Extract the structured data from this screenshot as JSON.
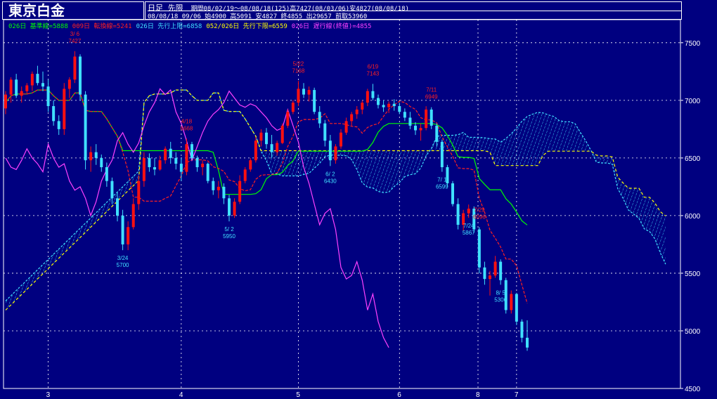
{
  "title": "東京白金",
  "info": {
    "line1_label": "日足 先限",
    "line1": "期間08/02/19～08/08/18(125)高7427(08/03/06)安4827(08/08/18)",
    "line2": "08/08/18 09/06 始4900 高5091 安4827 終4855 出29657 前取53960"
  },
  "legend": [
    {
      "text": "026日 基準線=5888",
      "color": "#00ff00"
    },
    {
      "text": "009日 転換線=5241",
      "color": "#ff2020"
    },
    {
      "text": "026日 先行上限=6858",
      "color": "#40e0ff"
    },
    {
      "text": "052/026日 先行下限=6559",
      "color": "#ffff00"
    },
    {
      "text": "026日 遅行線(終値)=4855",
      "color": "#ff40ff"
    }
  ],
  "colors": {
    "background": "#000080",
    "grid": "#ffffff",
    "up_candle": "#ff1010",
    "down_candle": "#40e0ff",
    "kijun": "#00ff00",
    "tenkan": "#ff2020",
    "span_a": "#40e0ff",
    "span_b": "#ffff00",
    "chikou": "#ff40ff",
    "annotation_high": "#ff2020",
    "annotation_low": "#40e0ff"
  },
  "chart_data": {
    "type": "candlestick",
    "ylim": [
      4500,
      7700
    ],
    "y_ticks": [
      "7500",
      "7000",
      "6500",
      "6000",
      "5500",
      "5000",
      "4500"
    ],
    "x_ticks": [
      "3",
      "4",
      "5",
      "6",
      "7",
      "8"
    ],
    "annotations": [
      {
        "kind": "high",
        "date": "3/ 6",
        "value": "7427"
      },
      {
        "kind": "low",
        "date": "3/24",
        "value": "5700"
      },
      {
        "kind": "high",
        "date": "4/18",
        "value": "6668"
      },
      {
        "kind": "low",
        "date": "5/ 2",
        "value": "5950"
      },
      {
        "kind": "high",
        "date": "5/22",
        "value": "7168"
      },
      {
        "kind": "low",
        "date": "6/ 2",
        "value": "6430"
      },
      {
        "kind": "high",
        "date": "6/19",
        "value": "7143"
      },
      {
        "kind": "high",
        "date": "7/11",
        "value": "6949"
      },
      {
        "kind": "low",
        "date": "7/ 1",
        "value": "6599"
      },
      {
        "kind": "high",
        "date": "7/29",
        "value": "6096"
      },
      {
        "kind": "low",
        "date": "7/24",
        "value": "5867"
      },
      {
        "kind": "low",
        "date": "8/ 5",
        "value": "5306"
      }
    ],
    "candles_ohlc": [
      [
        6930,
        7080,
        6880,
        7050
      ],
      [
        7050,
        7200,
        6980,
        7180
      ],
      [
        7180,
        7230,
        7020,
        7040
      ],
      [
        7040,
        7120,
        6980,
        7080
      ],
      [
        7080,
        7150,
        7050,
        7130
      ],
      [
        7130,
        7250,
        7080,
        7230
      ],
      [
        7230,
        7300,
        7130,
        7150
      ],
      [
        7150,
        7250,
        7080,
        7120
      ],
      [
        7120,
        7180,
        6900,
        6950
      ],
      [
        6950,
        7000,
        6780,
        6820
      ],
      [
        6820,
        6870,
        6700,
        6750
      ],
      [
        6750,
        7150,
        6700,
        7100
      ],
      [
        7100,
        7200,
        7020,
        7180
      ],
      [
        7180,
        7427,
        7150,
        7380
      ],
      [
        7380,
        7400,
        7000,
        7050
      ],
      [
        7050,
        7080,
        6400,
        6480
      ],
      [
        6480,
        6600,
        6380,
        6550
      ],
      [
        6550,
        6620,
        6440,
        6500
      ],
      [
        6500,
        6530,
        6380,
        6420
      ],
      [
        6420,
        6460,
        6250,
        6300
      ],
      [
        6300,
        6330,
        6100,
        6150
      ],
      [
        6150,
        6200,
        5950,
        6000
      ],
      [
        6000,
        6050,
        5700,
        5750
      ],
      [
        5750,
        5950,
        5700,
        5900
      ],
      [
        5900,
        6150,
        5880,
        6100
      ],
      [
        6100,
        6350,
        6050,
        6300
      ],
      [
        6300,
        6550,
        6250,
        6500
      ],
      [
        6500,
        6540,
        6380,
        6420
      ],
      [
        6420,
        6500,
        6350,
        6400
      ],
      [
        6400,
        6520,
        6390,
        6480
      ],
      [
        6480,
        6600,
        6450,
        6580
      ],
      [
        6580,
        6640,
        6450,
        6500
      ],
      [
        6500,
        6550,
        6400,
        6450
      ],
      [
        6450,
        6500,
        6300,
        6380
      ],
      [
        6380,
        6668,
        6350,
        6620
      ],
      [
        6620,
        6640,
        6480,
        6500
      ],
      [
        6500,
        6520,
        6380,
        6420
      ],
      [
        6420,
        6480,
        6350,
        6450
      ],
      [
        6450,
        6460,
        6280,
        6300
      ],
      [
        6300,
        6330,
        6180,
        6220
      ],
      [
        6220,
        6300,
        6150,
        6250
      ],
      [
        6250,
        6280,
        6100,
        6150
      ],
      [
        6150,
        6180,
        5950,
        6000
      ],
      [
        6000,
        6150,
        5980,
        6120
      ],
      [
        6120,
        6350,
        6100,
        6300
      ],
      [
        6300,
        6420,
        6280,
        6400
      ],
      [
        6400,
        6500,
        6380,
        6480
      ],
      [
        6480,
        6680,
        6460,
        6650
      ],
      [
        6650,
        6750,
        6600,
        6720
      ],
      [
        6720,
        6760,
        6580,
        6620
      ],
      [
        6620,
        6700,
        6500,
        6550
      ],
      [
        6550,
        6650,
        6520,
        6630
      ],
      [
        6630,
        6800,
        6620,
        6780
      ],
      [
        6780,
        6920,
        6760,
        6900
      ],
      [
        6900,
        7000,
        6880,
        6980
      ],
      [
        6980,
        7168,
        6950,
        7100
      ],
      [
        7100,
        7150,
        7020,
        7050
      ],
      [
        7050,
        7120,
        6990,
        7090
      ],
      [
        7090,
        7110,
        6880,
        6900
      ],
      [
        6900,
        6950,
        6760,
        6800
      ],
      [
        6800,
        6830,
        6600,
        6650
      ],
      [
        6650,
        6700,
        6430,
        6480
      ],
      [
        6480,
        6620,
        6450,
        6600
      ],
      [
        6600,
        6750,
        6580,
        6720
      ],
      [
        6720,
        6850,
        6700,
        6820
      ],
      [
        6820,
        6900,
        6780,
        6880
      ],
      [
        6880,
        6950,
        6840,
        6920
      ],
      [
        6920,
        7000,
        6880,
        6980
      ],
      [
        6980,
        7100,
        6950,
        7080
      ],
      [
        7080,
        7143,
        7000,
        7020
      ],
      [
        7020,
        7050,
        6930,
        6960
      ],
      [
        6960,
        7000,
        6900,
        6940
      ],
      [
        6940,
        6990,
        6890,
        6970
      ],
      [
        6970,
        7010,
        6910,
        6950
      ],
      [
        6950,
        6980,
        6880,
        6900
      ],
      [
        6900,
        6930,
        6820,
        6850
      ],
      [
        6850,
        6900,
        6750,
        6780
      ],
      [
        6780,
        6810,
        6700,
        6740
      ],
      [
        6740,
        6800,
        6650,
        6760
      ],
      [
        6760,
        6949,
        6740,
        6920
      ],
      [
        6920,
        6940,
        6750,
        6780
      ],
      [
        6780,
        6800,
        6599,
        6640
      ],
      [
        6640,
        6660,
        6380,
        6420
      ],
      [
        6420,
        6440,
        6250,
        6280
      ],
      [
        6280,
        6300,
        6080,
        6100
      ],
      [
        6100,
        6150,
        5880,
        5920
      ],
      [
        5920,
        6050,
        5867,
        6020
      ],
      [
        6020,
        6096,
        5980,
        6060
      ],
      [
        6060,
        6080,
        5850,
        5880
      ],
      [
        5880,
        5900,
        5500,
        5550
      ],
      [
        5550,
        5600,
        5400,
        5450
      ],
      [
        5450,
        5520,
        5306,
        5480
      ],
      [
        5480,
        5650,
        5460,
        5600
      ],
      [
        5600,
        5620,
        5400,
        5440
      ],
      [
        5440,
        5460,
        5150,
        5180
      ],
      [
        5180,
        5350,
        5150,
        5320
      ],
      [
        5320,
        5330,
        5050,
        5080
      ],
      [
        5080,
        5100,
        4900,
        4940
      ],
      [
        4940,
        5091,
        4827,
        4855
      ]
    ]
  }
}
